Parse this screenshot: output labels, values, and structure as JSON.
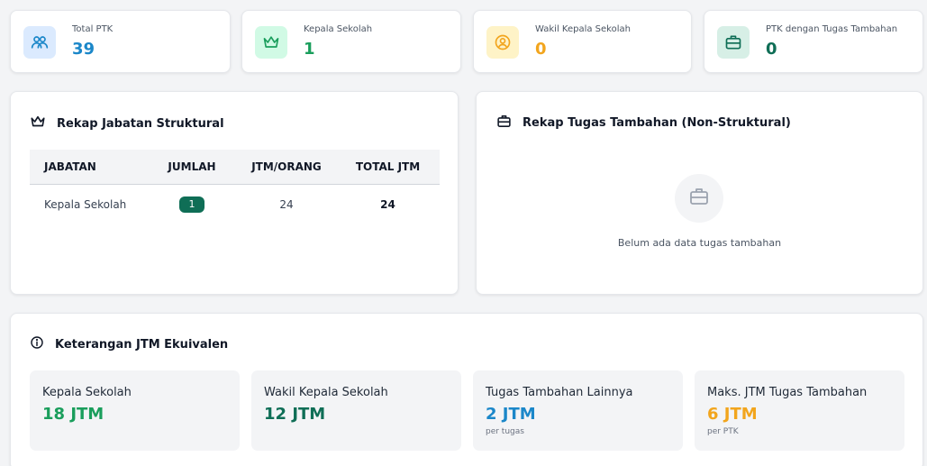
{
  "colors": {
    "blue": "#1b87c9",
    "green": "#1a9e5c",
    "teal": "#0f6e56",
    "orange": "#f2a51d"
  },
  "stats": [
    {
      "label": "Total PTK",
      "value": "39",
      "icon": "users-icon",
      "color": "#1b87c9",
      "bg": "#dbeafe"
    },
    {
      "label": "Kepala Sekolah",
      "value": "1",
      "icon": "crown-icon",
      "color": "#1a9e5c",
      "bg": "#d1fae5"
    },
    {
      "label": "Wakil Kepala Sekolah",
      "value": "0",
      "icon": "user-circle-icon",
      "color": "#f2a51d",
      "bg": "#fef3c7"
    },
    {
      "label": "PTK dengan Tugas Tambahan",
      "value": "0",
      "icon": "briefcase-icon",
      "color": "#0f6e56",
      "bg": "#d7efe6"
    }
  ],
  "struktural": {
    "title": "Rekap Jabatan Struktural",
    "columns": [
      "JABATAN",
      "JUMLAH",
      "JTM/ORANG",
      "TOTAL JTM"
    ],
    "rows": [
      {
        "jabatan": "Kepala Sekolah",
        "jumlah": "1",
        "jtm_orang": "24",
        "total_jtm": "24"
      }
    ]
  },
  "tambahan": {
    "title": "Rekap Tugas Tambahan (Non-Struktural)",
    "empty_text": "Belum ada data tugas tambahan"
  },
  "keterangan": {
    "title": "Keterangan JTM Ekuivalen",
    "items": [
      {
        "title": "Kepala Sekolah",
        "value": "18 JTM",
        "sub": "",
        "color": "#1a9e5c"
      },
      {
        "title": "Wakil Kepala Sekolah",
        "value": "12 JTM",
        "sub": "",
        "color": "#0f6e56"
      },
      {
        "title": "Tugas Tambahan Lainnya",
        "value": "2 JTM",
        "sub": "per tugas",
        "color": "#1b87c9"
      },
      {
        "title": "Maks. JTM Tugas Tambahan",
        "value": "6 JTM",
        "sub": "per PTK",
        "color": "#f2a51d"
      }
    ]
  }
}
